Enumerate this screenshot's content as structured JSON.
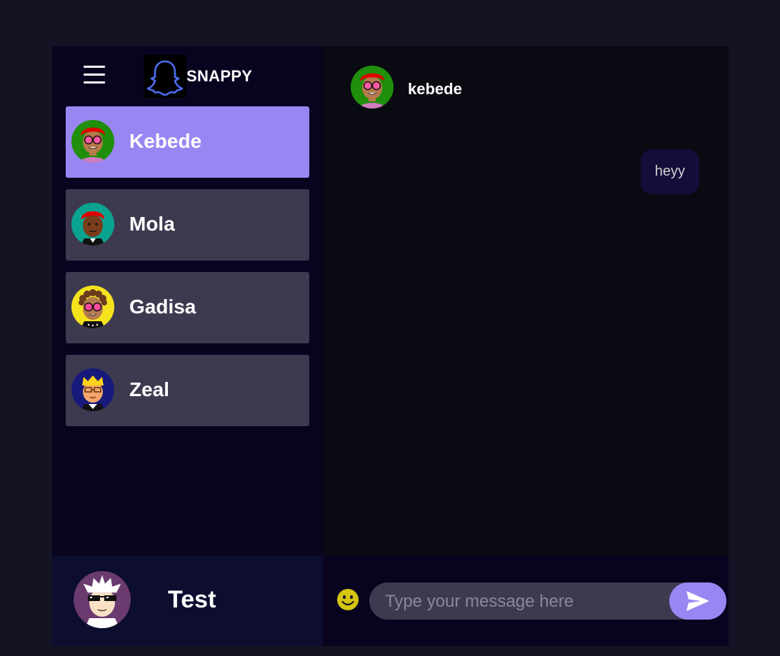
{
  "brand": {
    "name": "SNAPPY",
    "logo_icon": "snapchat-ghost-icon"
  },
  "contacts": [
    {
      "name": "Kebede",
      "selected": true,
      "avatar": "red-hair-sunglasses-avatar"
    },
    {
      "name": "Mola",
      "selected": false,
      "avatar": "red-hair-suit-avatar"
    },
    {
      "name": "Gadisa",
      "selected": false,
      "avatar": "curly-hair-sunglasses-avatar"
    },
    {
      "name": "Zeal",
      "selected": false,
      "avatar": "blonde-glasses-avatar"
    }
  ],
  "current_user": {
    "name": "Test",
    "avatar": "white-hair-pixel-glasses-avatar"
  },
  "chat": {
    "contact_name": "kebede",
    "messages": [
      {
        "text": "heyy",
        "sent": true
      }
    ]
  },
  "input": {
    "placeholder": "Type your message here",
    "value": ""
  },
  "colors": {
    "page_bg": "#131324",
    "sidebar_bg": "#080420",
    "chat_bg": "#0a0a13",
    "contact_bg": "#3d3a50",
    "selected_contact_bg": "#9a86f3",
    "accent": "#9a86f3",
    "bubble_bg": "#150c39",
    "emoji_yellow": "#d4c513"
  }
}
